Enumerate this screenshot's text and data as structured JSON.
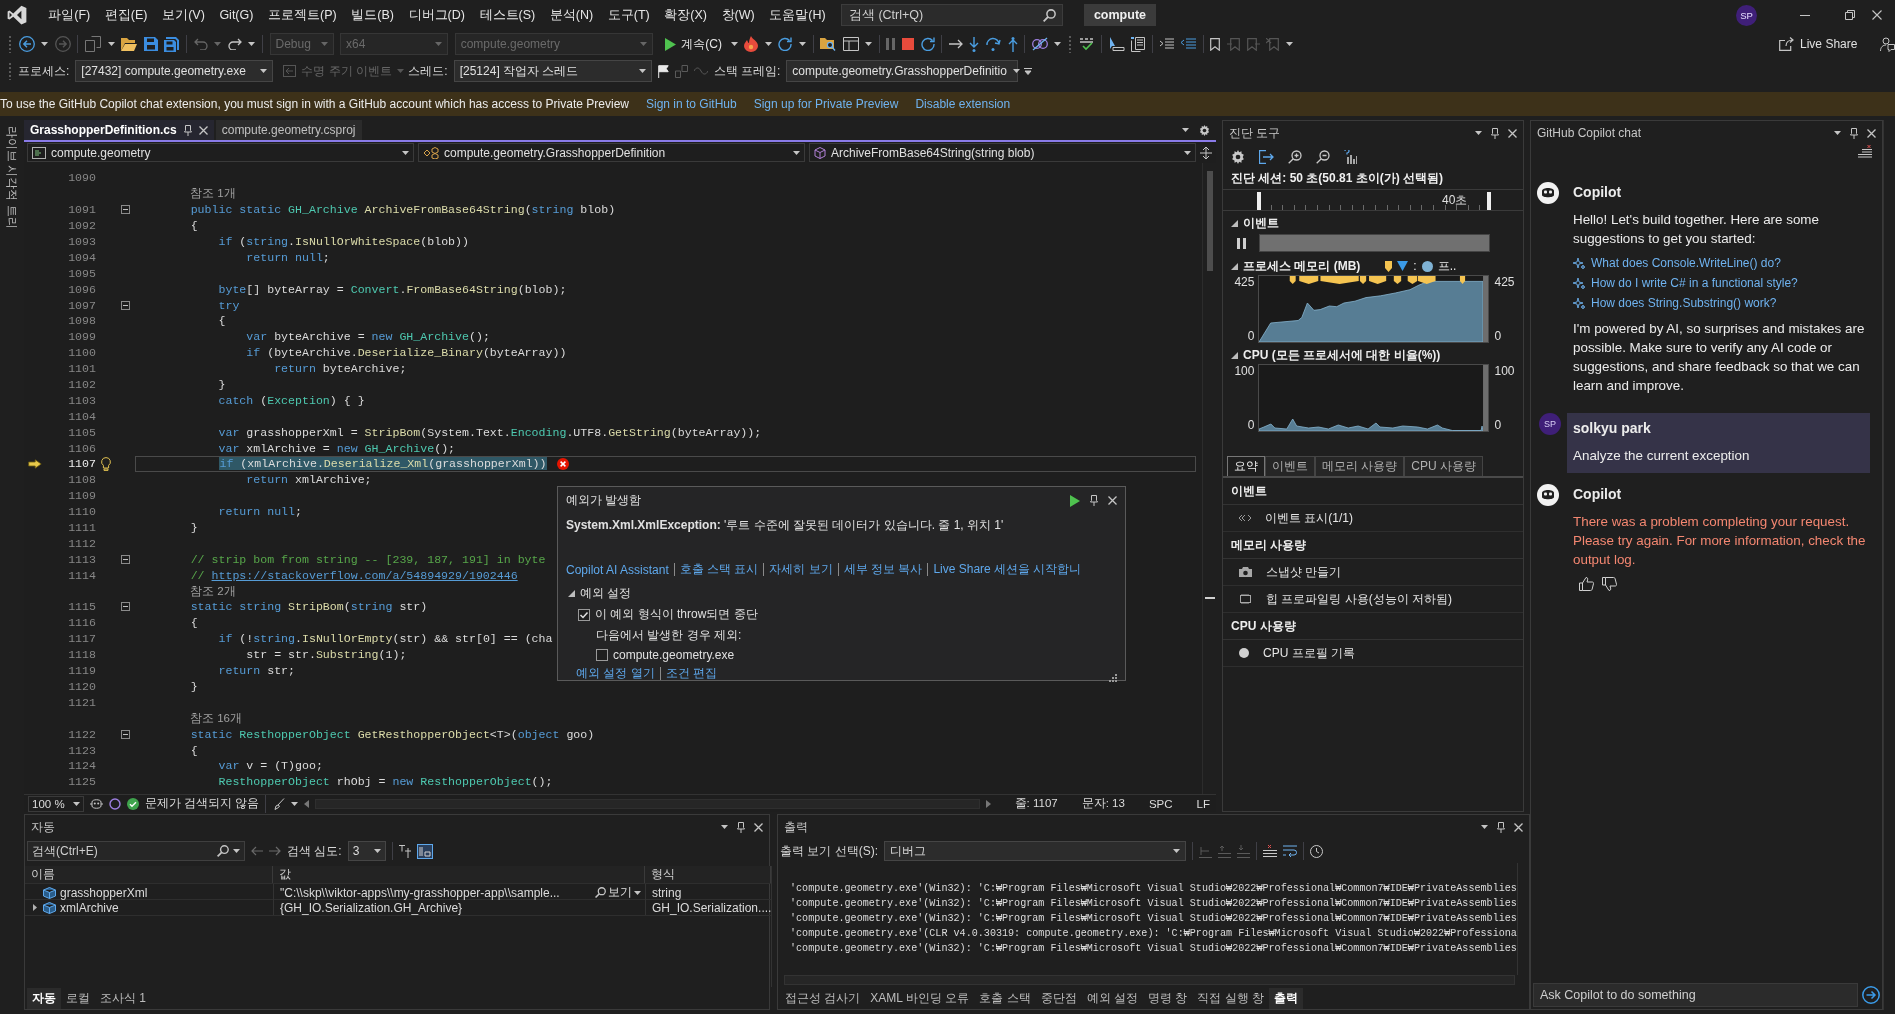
{
  "menu_bar": {
    "items": [
      "파일(F)",
      "편집(E)",
      "보기(V)",
      "Git(G)",
      "프로젝트(P)",
      "빌드(B)",
      "디버그(D)",
      "테스트(S)",
      "분석(N)",
      "도구(T)",
      "확장(X)",
      "창(W)",
      "도움말(H)"
    ],
    "search": {
      "placeholder": "검색 (Ctrl+Q)"
    },
    "solution": "compute",
    "account_initials": "SP"
  },
  "toolbar": {
    "configuration": {
      "value": "Debug",
      "disabled": true
    },
    "platform": {
      "value": "x64",
      "disabled": true
    },
    "startup_item": {
      "value": "compute.geometry",
      "disabled": true
    },
    "continue_label": "계속(C)",
    "live_share": "Live Share"
  },
  "debug_location": {
    "process_label": "프로세스:",
    "process": "[27432] compute.geometry.exe",
    "lifecycle_events": {
      "label": "수명 주기 이벤트",
      "disabled": true
    },
    "thread_label": "스레드:",
    "thread": "[25124] 작업자 스레드",
    "stack_frame_label": "스택 프레임:",
    "stack_frame": "compute.geometry.GrasshopperDefinitio"
  },
  "info_bar": {
    "message": "To use the GitHub Copilot chat extension, you must sign in with a GitHub account which has access to Private Preview",
    "links": [
      "Sign in to GitHub",
      "Sign up for Private Preview",
      "Disable extension"
    ]
  },
  "side_tabs": [
    "라이브 시각적 트리"
  ],
  "editor": {
    "tabs": [
      {
        "label": "GrasshopperDefinition.cs",
        "selected": true
      },
      {
        "label": "compute.geometry.csproj",
        "selected": false
      }
    ],
    "navigation": {
      "project": "compute.geometry",
      "type": "compute.geometry.GrasshopperDefinition",
      "member": "ArchiveFromBase64String(string blob)"
    },
    "lines": [
      {
        "kind": "code",
        "number": "1090",
        "fold": false
      },
      {
        "kind": "lens",
        "text": "참조 1개"
      },
      {
        "kind": "code",
        "number": "1091",
        "fold": true,
        "tokens": [
          {
            "text": "        public static ",
            "kind": "keyword"
          },
          {
            "text": "GH_Archive",
            "kind": "type"
          },
          {
            "text": " ArchiveFromBase64String",
            "kind": "method"
          },
          {
            "text": "(",
            "kind": "plain"
          },
          {
            "text": "string",
            "kind": "keyword"
          },
          {
            "text": " blob)",
            "kind": "plain"
          }
        ]
      },
      {
        "kind": "code",
        "number": "1092",
        "fold": false,
        "tokens": [
          {
            "text": "        {",
            "kind": "plain"
          }
        ]
      },
      {
        "kind": "code",
        "number": "1093",
        "fold": false,
        "tokens": [
          {
            "text": "            if",
            "kind": "keyword"
          },
          {
            "text": " (",
            "kind": "plain"
          },
          {
            "text": "string",
            "kind": "keyword"
          },
          {
            "text": ".",
            "kind": "plain"
          },
          {
            "text": "IsNullOrWhiteSpace",
            "kind": "method"
          },
          {
            "text": "(blob))",
            "kind": "plain"
          }
        ]
      },
      {
        "kind": "code",
        "number": "1094",
        "fold": false,
        "tokens": [
          {
            "text": "                return null",
            "kind": "keyword"
          },
          {
            "text": ";",
            "kind": "plain"
          }
        ]
      },
      {
        "kind": "code",
        "number": "1095",
        "fold": false
      },
      {
        "kind": "code",
        "number": "1096",
        "fold": false,
        "tokens": [
          {
            "text": "            byte",
            "kind": "keyword"
          },
          {
            "text": "[] byteArray = ",
            "kind": "plain"
          },
          {
            "text": "Convert",
            "kind": "type"
          },
          {
            "text": ".",
            "kind": "plain"
          },
          {
            "text": "FromBase64String",
            "kind": "method"
          },
          {
            "text": "(blob);",
            "kind": "plain"
          }
        ]
      },
      {
        "kind": "code",
        "number": "1097",
        "fold": true,
        "tokens": [
          {
            "text": "            try",
            "kind": "keyword"
          }
        ]
      },
      {
        "kind": "code",
        "number": "1098",
        "fold": false,
        "tokens": [
          {
            "text": "            {",
            "kind": "plain"
          }
        ]
      },
      {
        "kind": "code",
        "number": "1099",
        "fold": false,
        "tokens": [
          {
            "text": "                var",
            "kind": "keyword"
          },
          {
            "text": " byteArchive = ",
            "kind": "plain"
          },
          {
            "text": "new ",
            "kind": "keyword"
          },
          {
            "text": "GH_Archive",
            "kind": "type"
          },
          {
            "text": "();",
            "kind": "plain"
          }
        ]
      },
      {
        "kind": "code",
        "number": "1100",
        "fold": false,
        "tokens": [
          {
            "text": "                if",
            "kind": "keyword"
          },
          {
            "text": " (byteArchive.",
            "kind": "plain"
          },
          {
            "text": "Deserialize_Binary",
            "kind": "method"
          },
          {
            "text": "(byteArray))",
            "kind": "plain"
          }
        ]
      },
      {
        "kind": "code",
        "number": "1101",
        "fold": false,
        "tokens": [
          {
            "text": "                    return",
            "kind": "keyword"
          },
          {
            "text": " byteArchive;",
            "kind": "plain"
          }
        ]
      },
      {
        "kind": "code",
        "number": "1102",
        "fold": false,
        "tokens": [
          {
            "text": "            }",
            "kind": "plain"
          }
        ]
      },
      {
        "kind": "code",
        "number": "1103",
        "fold": false,
        "tokens": [
          {
            "text": "            catch",
            "kind": "keyword"
          },
          {
            "text": " (",
            "kind": "plain"
          },
          {
            "text": "Exception",
            "kind": "type"
          },
          {
            "text": ") { }",
            "kind": "plain"
          }
        ]
      },
      {
        "kind": "code",
        "number": "1104",
        "fold": false
      },
      {
        "kind": "code",
        "number": "1105",
        "fold": false,
        "tokens": [
          {
            "text": "            var",
            "kind": "keyword"
          },
          {
            "text": " grasshopperXml = ",
            "kind": "plain"
          },
          {
            "text": "StripBom",
            "kind": "method"
          },
          {
            "text": "(System.Text.",
            "kind": "plain"
          },
          {
            "text": "Encoding",
            "kind": "type"
          },
          {
            "text": ".UTF8.",
            "kind": "plain"
          },
          {
            "text": "GetString",
            "kind": "method"
          },
          {
            "text": "(byteArray));",
            "kind": "plain"
          }
        ]
      },
      {
        "kind": "code",
        "number": "1106",
        "fold": false,
        "tokens": [
          {
            "text": "            var",
            "kind": "keyword"
          },
          {
            "text": " xmlArchive = ",
            "kind": "plain"
          },
          {
            "text": "new ",
            "kind": "keyword"
          },
          {
            "text": "GH_Archive",
            "kind": "type"
          },
          {
            "text": "();",
            "kind": "plain"
          }
        ]
      },
      {
        "kind": "current",
        "number": "1107",
        "fold": false,
        "tokens": [
          {
            "text": "            if",
            "kind": "keyword"
          },
          {
            "text": " (xmlArchive.",
            "kind": "plain"
          },
          {
            "text": "Deserialize_Xml",
            "kind": "method"
          },
          {
            "text": "(grasshopperXml))",
            "kind": "plain"
          }
        ]
      },
      {
        "kind": "code",
        "number": "1108",
        "fold": false,
        "tokens": [
          {
            "text": "                return",
            "kind": "keyword"
          },
          {
            "text": " xmlArchive;",
            "kind": "plain"
          }
        ]
      },
      {
        "kind": "code",
        "number": "1109",
        "fold": false
      },
      {
        "kind": "code",
        "number": "1110",
        "fold": false,
        "tokens": [
          {
            "text": "            return null",
            "kind": "keyword"
          },
          {
            "text": ";",
            "kind": "plain"
          }
        ]
      },
      {
        "kind": "code",
        "number": "1111",
        "fold": false,
        "tokens": [
          {
            "text": "        }",
            "kind": "plain"
          }
        ]
      },
      {
        "kind": "code",
        "number": "1112",
        "fold": false
      },
      {
        "kind": "code",
        "number": "1113",
        "fold": true,
        "tokens": [
          {
            "text": "        // strip bom from string -- [239, 187, 191] in byte",
            "kind": "comment"
          }
        ]
      },
      {
        "kind": "code",
        "number": "1114",
        "fold": false,
        "tokens": [
          {
            "text": "        // ",
            "kind": "comment"
          },
          {
            "text": "https://stackoverflow.com/a/54894929/1902446",
            "kind": "link"
          }
        ]
      },
      {
        "kind": "lens",
        "text": "참조 2개"
      },
      {
        "kind": "code",
        "number": "1115",
        "fold": true,
        "tokens": [
          {
            "text": "        static string ",
            "kind": "keyword"
          },
          {
            "text": "StripBom",
            "kind": "method"
          },
          {
            "text": "(",
            "kind": "plain"
          },
          {
            "text": "string",
            "kind": "keyword"
          },
          {
            "text": " str)",
            "kind": "plain"
          }
        ]
      },
      {
        "kind": "code",
        "number": "1116",
        "fold": false,
        "tokens": [
          {
            "text": "        {",
            "kind": "plain"
          }
        ]
      },
      {
        "kind": "code",
        "number": "1117",
        "fold": false,
        "tokens": [
          {
            "text": "            if",
            "kind": "keyword"
          },
          {
            "text": " (!",
            "kind": "plain"
          },
          {
            "text": "string",
            "kind": "keyword"
          },
          {
            "text": ".",
            "kind": "plain"
          },
          {
            "text": "IsNullOrEmpty",
            "kind": "method"
          },
          {
            "text": "(str) && str[0] == (cha",
            "kind": "plain"
          }
        ]
      },
      {
        "kind": "code",
        "number": "1118",
        "fold": false,
        "tokens": [
          {
            "text": "                str = str.",
            "kind": "plain"
          },
          {
            "text": "Substring",
            "kind": "method"
          },
          {
            "text": "(1);",
            "kind": "plain"
          }
        ]
      },
      {
        "kind": "code",
        "number": "1119",
        "fold": false,
        "tokens": [
          {
            "text": "            return",
            "kind": "keyword"
          },
          {
            "text": " str;",
            "kind": "plain"
          }
        ]
      },
      {
        "kind": "code",
        "number": "1120",
        "fold": false,
        "tokens": [
          {
            "text": "        }",
            "kind": "plain"
          }
        ]
      },
      {
        "kind": "code",
        "number": "1121",
        "fold": false
      },
      {
        "kind": "lens",
        "text": "참조 16개"
      },
      {
        "kind": "code",
        "number": "1122",
        "fold": true,
        "tokens": [
          {
            "text": "        static ",
            "kind": "keyword"
          },
          {
            "text": "ResthopperObject",
            "kind": "type"
          },
          {
            "text": " GetResthopperObject",
            "kind": "method"
          },
          {
            "text": "<T>(",
            "kind": "plain"
          },
          {
            "text": "object",
            "kind": "keyword"
          },
          {
            "text": " goo)",
            "kind": "plain"
          }
        ]
      },
      {
        "kind": "code",
        "number": "1123",
        "fold": false,
        "tokens": [
          {
            "text": "        {",
            "kind": "plain"
          }
        ]
      },
      {
        "kind": "code",
        "number": "1124",
        "fold": false,
        "tokens": [
          {
            "text": "            var",
            "kind": "keyword"
          },
          {
            "text": " v = (T)goo;",
            "kind": "plain"
          }
        ]
      },
      {
        "kind": "code",
        "number": "1125",
        "fold": false,
        "tokens": [
          {
            "text": "            ResthopperObject",
            "kind": "type"
          },
          {
            "text": " rhObj = ",
            "kind": "plain"
          },
          {
            "text": "new ",
            "kind": "keyword"
          },
          {
            "text": "ResthopperObject",
            "kind": "type"
          },
          {
            "text": "();",
            "kind": "plain"
          }
        ]
      }
    ],
    "exception": {
      "title": "예외가 발생함",
      "message": "**System.Xml.XmlException:** '루트 수준에 잘못된 데이터가 있습니다. 줄 1, 위치 1'",
      "links": [
        "Copilot AI Assistant",
        "호출 스택 표시",
        "자세히 보기",
        "세부 정보 복사",
        "Live Share 세션을 시작합니"
      ],
      "settings": {
        "title": "예외 설정",
        "expanded": true,
        "break_when_thrown": {
          "label": "이 예외 형식이 throw되면 중단",
          "checked": true
        },
        "except_label": "다음에서 발생한 경우 제외:",
        "exclusions": [
          {
            "label": "compute.geometry.exe",
            "checked": false
          }
        ]
      },
      "footer_links": [
        "예외 설정 열기",
        "조건 편집"
      ]
    },
    "status": {
      "zoom": "100 %",
      "issues": "문제가 검색되지 않음",
      "line": "줄: 1107",
      "column": "문자: 13",
      "whitespace": "SPC",
      "line_ending": "LF"
    }
  },
  "diagnostic_tools": {
    "title": "진단 도구",
    "session": "진단 세션: 50 초(50.81 초이(가) 선택됨)",
    "timeline_label": "40초",
    "events": {
      "title": "이벤트",
      "expanded": true
    },
    "process_memory": {
      "title": "프로세스 메모리 (MB)",
      "expanded": true,
      "legend": [
        {
          "kind": "gc"
        },
        {
          "kind": "snapshot",
          "label": ":"
        },
        {
          "kind": "private_bytes",
          "label": "프.."
        }
      ],
      "left_labels": [
        "425",
        "0"
      ],
      "right_labels": [
        "425",
        "0"
      ]
    },
    "cpu": {
      "title": "CPU (모든 프로세서에 대한 비율(%))",
      "expanded": true,
      "left_labels": [
        "100",
        "0"
      ],
      "right_labels": [
        "100",
        "0"
      ]
    },
    "tabs": [
      {
        "label": "요약",
        "selected": true
      },
      {
        "label": "이벤트",
        "selected": false
      },
      {
        "label": "메모리 사용량",
        "selected": false
      },
      {
        "label": "CPU 사용량",
        "selected": false
      }
    ],
    "sections": [
      {
        "title": "이벤트",
        "items": [
          {
            "kind": "events",
            "label": "이벤트 표시(1/1)"
          }
        ]
      },
      {
        "title": "메모리 사용량",
        "items": [
          {
            "kind": "snapshot",
            "label": "스냅샷 만들기"
          },
          {
            "kind": "heap",
            "label": "힙 프로파일링 사용(성능이 저하됨)"
          }
        ]
      },
      {
        "title": "CPU 사용량",
        "items": [
          {
            "kind": "record",
            "label": "CPU 프로필 기록"
          }
        ]
      }
    ]
  },
  "copilot_chat": {
    "title": "GitHub Copilot chat",
    "messages": [
      {
        "kind": "assistant",
        "author": "Copilot",
        "text": "Hello! Let's build together. Here are some suggestions to get you started:",
        "suggestions": [
          "What does Console.WriteLine() do?",
          "How do I write C# in a functional style?",
          "How does String.Substring() work?"
        ],
        "note": "I'm powered by AI, so surprises and mistakes are possible. Make sure to verify any AI code or suggestions, and share feedback so that we can learn and improve."
      },
      {
        "kind": "user",
        "author": "solkyu park",
        "initials": "SP",
        "text": "Analyze the current exception"
      },
      {
        "kind": "error",
        "author": "Copilot",
        "text": "There was a problem completing your request. Please try again. For more information, check the output log."
      }
    ],
    "input": {
      "placeholder": "Ask Copilot to do something"
    }
  },
  "autos": {
    "title": "자동",
    "search": {
      "placeholder": "검색(Ctrl+E)"
    },
    "depth_label": "검색 심도:",
    "depth": "3",
    "columns": [
      "이름",
      "값",
      "형식"
    ],
    "rows": [
      {
        "name": "grasshopperXml",
        "value": "\"C:\\\\skp\\\\viktor-apps\\\\my-grasshopper-app\\\\sample...",
        "visualizer": "보기",
        "type": "string",
        "expandable": false
      },
      {
        "name": "xmlArchive",
        "value": "{GH_IO.Serialization.GH_Archive}",
        "type": "GH_IO.Serialization....",
        "expandable": true
      }
    ],
    "tabs": [
      {
        "label": "자동",
        "selected": true
      },
      {
        "label": "로컬",
        "selected": false
      },
      {
        "label": "조사식 1",
        "selected": false
      }
    ]
  },
  "output": {
    "title": "출력",
    "source_label": "출력 보기 선택(S):",
    "source": "디버그",
    "lines": [
      "'compute.geometry.exe'(Win32): 'C:₩Program Files₩Microsoft Visual Studio₩2022₩Professional₩Common7₩IDE₩PrivateAssemblies",
      "'compute.geometry.exe'(Win32): 'C:₩Program Files₩Microsoft Visual Studio₩2022₩Professional₩Common7₩IDE₩PrivateAssemblies",
      "'compute.geometry.exe'(Win32): 'C:₩Program Files₩Microsoft Visual Studio₩2022₩Professional₩Common7₩IDE₩PrivateAssemblies",
      "'compute.geometry.exe'(CLR v4.0.30319: compute.geometry.exe): 'C:₩Program Files₩Microsoft Visual Studio₩2022₩Professiona",
      "'compute.geometry.exe'(Win32): 'C:₩Program Files₩Microsoft Visual Studio₩2022₩Professional₩Common7₩IDE₩PrivateAssemblies"
    ],
    "tabs": [
      {
        "label": "접근성 검사기",
        "selected": false
      },
      {
        "label": "XAML 바인딩 오류",
        "selected": false
      },
      {
        "label": "호출 스택",
        "selected": false
      },
      {
        "label": "중단점",
        "selected": false
      },
      {
        "label": "예외 설정",
        "selected": false
      },
      {
        "label": "명령 창",
        "selected": false
      },
      {
        "label": "직접 실행 창",
        "selected": false
      },
      {
        "label": "출력",
        "selected": true
      }
    ]
  }
}
